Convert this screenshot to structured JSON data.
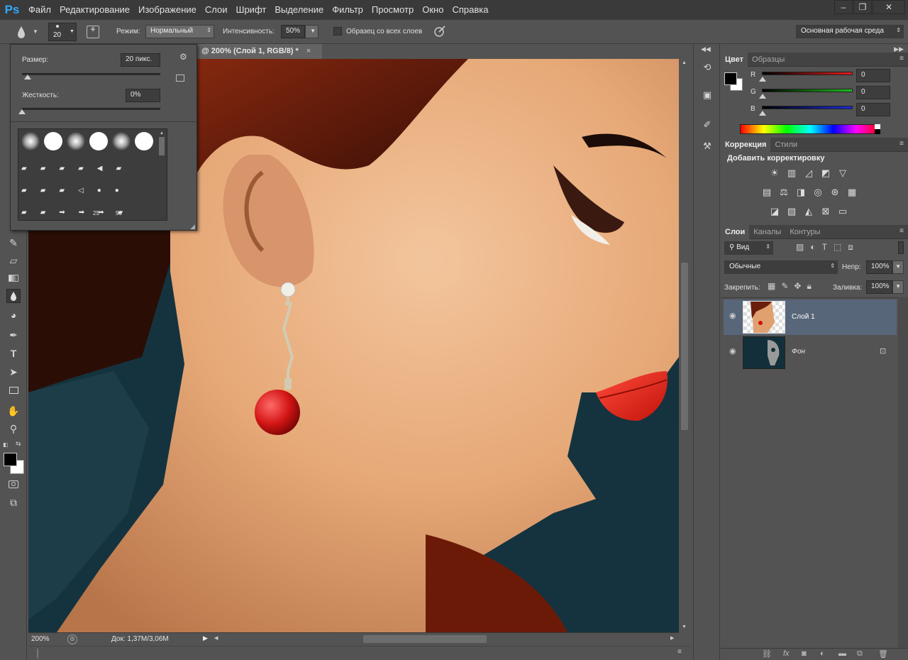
{
  "app": {
    "logo": "Ps"
  },
  "menu": [
    "Файл",
    "Редактирование",
    "Изображение",
    "Слои",
    "Шрифт",
    "Выделение",
    "Фильтр",
    "Просмотр",
    "Окно",
    "Справка"
  ],
  "window_controls": {
    "minimize": "–",
    "restore": "❐",
    "close": "✕"
  },
  "options": {
    "brush_size": "20",
    "mode_label": "Режим:",
    "mode_value": "Нормальный",
    "intensity_label": "Интенсивность:",
    "intensity_value": "50%",
    "sample_all_label": "Образец со всех слоев",
    "workspace": "Основная рабочая среда"
  },
  "brush_popup": {
    "size_label": "Размер:",
    "size_value": "20 пикс.",
    "size_slider": 0.04,
    "hardness_label": "Жесткость:",
    "hardness_value": "0%",
    "hardness_slider": 0.0,
    "preset_labels": [
      "25",
      "50"
    ]
  },
  "document": {
    "tab_title": "@ 200% (Слой 1, RGB/8) *",
    "close": "×",
    "zoom": "200%",
    "doc_info": "Док: 1,37M/3,06M"
  },
  "color_panel": {
    "tabs": [
      "Цвет",
      "Образцы"
    ],
    "channels": [
      {
        "label": "R",
        "value": "0",
        "color": "#e11b1b"
      },
      {
        "label": "G",
        "value": "0",
        "color": "#1bbf1b"
      },
      {
        "label": "B",
        "value": "0",
        "color": "#1b2bd9"
      }
    ]
  },
  "adjustments_panel": {
    "tabs": [
      "Коррекция",
      "Стили"
    ],
    "title": "Добавить корректировку",
    "icons_row1": [
      "brightness-icon",
      "levels-icon",
      "curves-icon",
      "exposure-icon",
      "vibrance-icon"
    ],
    "icons_row2": [
      "hue-sat-icon",
      "color-balance-icon",
      "bw-icon",
      "photo-filter-icon",
      "channel-mixer-icon",
      "color-lookup-icon"
    ],
    "icons_row3": [
      "invert-icon",
      "posterize-icon",
      "threshold-icon",
      "selective-color-icon",
      "gradient-map-icon"
    ]
  },
  "layers_panel": {
    "tabs": [
      "Слои",
      "Каналы",
      "Контуры"
    ],
    "filter": "Вид",
    "blend_mode": "Обычные",
    "opacity_label": "Непр:",
    "opacity_value": "100%",
    "lock_label": "Закрепить:",
    "fill_label": "Заливка:",
    "fill_value": "100%",
    "layers": [
      {
        "name": "Слой 1",
        "selected": true
      },
      {
        "name": "Фон",
        "selected": false,
        "locked": true
      }
    ]
  },
  "colors": {
    "accent": "#31a8ff",
    "panel": "#535353",
    "dark": "#3a3a3a",
    "selected_layer": "#58667a"
  }
}
